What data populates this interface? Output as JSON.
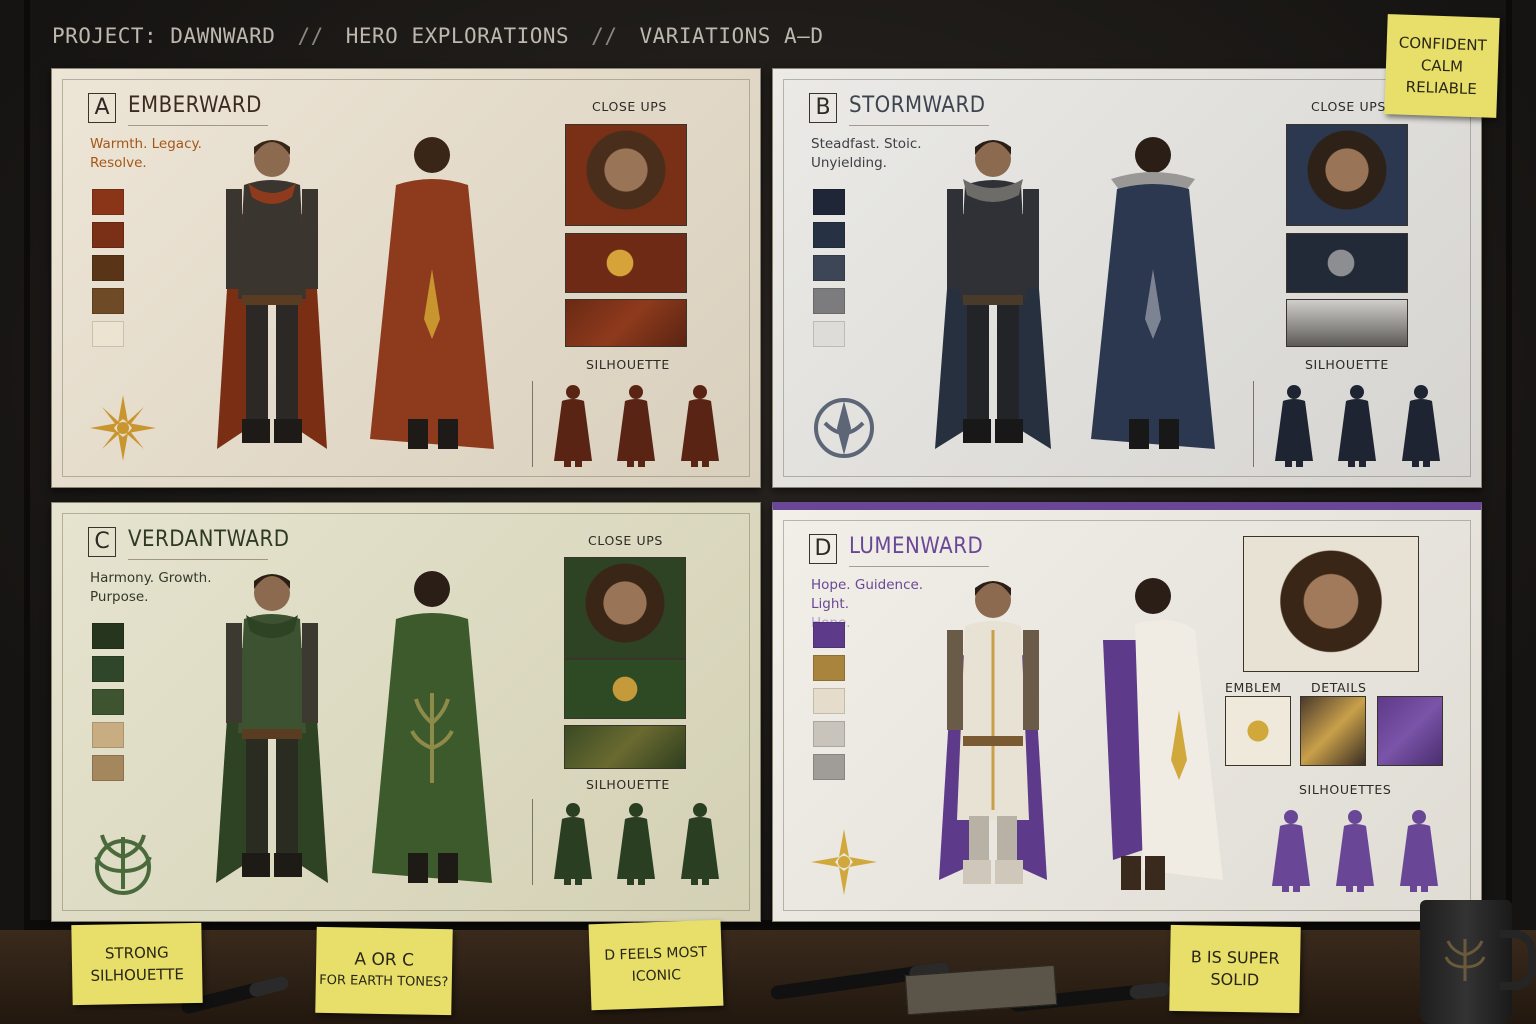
{
  "header": {
    "project": "PROJECT: DAWNWARD",
    "sep1": "//",
    "section": "HERO EXPLORATIONS",
    "sep2": "//",
    "variations": "VARIATIONS  A–D"
  },
  "sheets": [
    {
      "letter": "A",
      "name": "EMBERWARD",
      "tagline_1": "Warmth. Legacy.",
      "tagline_2": "Resolve.",
      "closeups_label": "CLOSE UPS",
      "silhouette_label": "SILHOUETTE",
      "palette": [
        "#8a3418",
        "#7a3016",
        "#5a3416",
        "#6e4a26",
        "#ece3d0"
      ],
      "accent": "#8e3a1c"
    },
    {
      "letter": "B",
      "name": "STORMWARD",
      "tagline_1": "Steadfast. Stoic.",
      "tagline_2": "Unyielding.",
      "closeups_label": "CLOSE UPS",
      "silhouette_label": "SILHOUETTE",
      "palette": [
        "#1e2638",
        "#263244",
        "#3c4656",
        "#7c7c7e",
        "#dedcd8"
      ],
      "accent": "#2c3850"
    },
    {
      "letter": "C",
      "name": "VERDANTWARD",
      "tagline_1": "Harmony. Growth.",
      "tagline_2": "Purpose.",
      "closeups_label": "CLOSE UPS",
      "silhouette_label": "SILHOUETTE",
      "palette": [
        "#26361e",
        "#30462a",
        "#3e5430",
        "#c8ad82",
        "#a4875c"
      ],
      "accent": "#3c5a2c"
    },
    {
      "letter": "D",
      "name": "LUMENWARD",
      "tagline_1": "Hope. Guidence. Light.",
      "tagline_2": "Hope.",
      "emblem_label": "EMBLEM",
      "details_label": "DETAILS",
      "silhouette_label": "SILHOUETTES",
      "palette": [
        "#5e3a8a",
        "#a8843c",
        "#e6dccb",
        "#c8c4bc",
        "#a09c98"
      ],
      "accent": "#6a4796"
    }
  ],
  "sticky_notes": {
    "top_right": [
      "CONFIDENT",
      "CALM",
      "RELIABLE"
    ],
    "note_1": [
      "STRONG",
      "SILHOUETTE"
    ],
    "note_2": [
      "A OR C",
      "FOR EARTH TONES?"
    ],
    "note_3": [
      "D FEELS MOST",
      "ICONIC"
    ],
    "note_4": [
      "B IS SUPER",
      "SOLID"
    ]
  }
}
